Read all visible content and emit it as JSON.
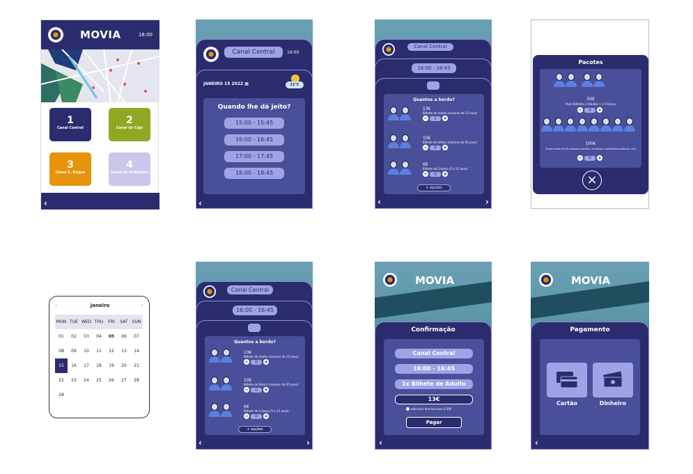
{
  "brand": "MOVIA",
  "time": "16:00",
  "home": {
    "tiles": [
      {
        "num": "1",
        "label": "Canal Central",
        "color": "#2b2c6e",
        "text": "#ffffff"
      },
      {
        "num": "2",
        "label": "Canal do Cojo",
        "color": "#8fa822",
        "text": "#ffffff"
      },
      {
        "num": "3",
        "label": "Canal S. Roque",
        "color": "#e8930c",
        "text": "#ffffff"
      },
      {
        "num": "4",
        "label": "Canal de Pirâmides",
        "color": "#c9c7ea",
        "text": "#ffffff"
      }
    ],
    "back": "‹"
  },
  "schedule": {
    "canal": "Canal Central",
    "time": "16:00",
    "date": "JANEIRO 15 2022",
    "temp": "22°C",
    "question": "Quando lhe dá jeito?",
    "slots": [
      "15:00 - 15:45",
      "16:00 - 16:45",
      "17:00 - 17:45",
      "18:00 - 18:45"
    ]
  },
  "tickets": {
    "canal": "Canal Central",
    "slot": "16:00 - 16:45",
    "question": "Quantos a bordo?",
    "options": "+ opções",
    "items": [
      {
        "price": "13€",
        "label": "Bilhete de Adulto (maiores de 12 anos)",
        "qty": "1"
      },
      {
        "price": "10€",
        "label": "Bilhete de Sénior (maiores de 65 anos)",
        "qty": "0"
      },
      {
        "price": "6€",
        "label": "Bilhete de Criança (5 a 12 anos)",
        "qty": "0"
      }
    ],
    "items_b": [
      {
        "price": "13€",
        "label": "Bilhete de Adulto (maiores de 12 anos)",
        "qty": "0"
      },
      {
        "price": "10€",
        "label": "Bilhete de Sénior (maiores de 65 anos)",
        "qty": "0"
      },
      {
        "price": "6€",
        "label": "Bilhete de Criança (5 a 12 anos)",
        "qty": "0"
      }
    ]
  },
  "packs": {
    "title": "Pacotes",
    "p1_price": "30€",
    "p1_label": "Pack Bilhetes 2 Adultos + 2 Criança",
    "p1_qty": "0",
    "p2_price": "100€",
    "p2_label": "Grupo acima de 20 pessoas (escolas, empresas, instituições públicas, etc)",
    "p2_qty": "0"
  },
  "calendar": {
    "month": "Janeiro",
    "days": [
      "MON",
      "TUE",
      "WED",
      "THU",
      "FRI",
      "SAT",
      "SUN"
    ],
    "rows": [
      [
        "01",
        "02",
        "03",
        "04",
        "05",
        "06",
        "07"
      ],
      [
        "08",
        "09",
        "10",
        "11",
        "12",
        "13",
        "14"
      ],
      [
        "15",
        "16",
        "17",
        "18",
        "19",
        "20",
        "21"
      ],
      [
        "22",
        "23",
        "24",
        "25",
        "26",
        "27",
        "28"
      ],
      [
        "28",
        "",
        "",
        "",
        "",
        "",
        ""
      ]
    ]
  },
  "confirm": {
    "title": "Confirmação",
    "canal": "Canal Central",
    "slot": "16:00 - 16:45",
    "ticket": "1x Bilhete de Adulto",
    "total": "13€",
    "brochure": "adicionar brochura por 0,50€",
    "pay": "Pagar"
  },
  "payment": {
    "title": "Pagamento",
    "card": "Cartão",
    "cash": "Dinheiro"
  }
}
